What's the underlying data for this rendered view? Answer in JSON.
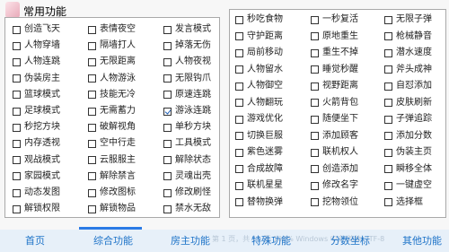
{
  "window": {
    "title": "常用功能"
  },
  "left_columns": [
    [
      {
        "label": "创造飞天",
        "checked": false
      },
      {
        "label": "人物穿墙",
        "checked": false
      },
      {
        "label": "人物连跳",
        "checked": false
      },
      {
        "label": "伪装房主",
        "checked": false
      },
      {
        "label": "篮球模式",
        "checked": false
      },
      {
        "label": "足球模式",
        "checked": false
      },
      {
        "label": "秒挖方块",
        "checked": false
      },
      {
        "label": "内存透视",
        "checked": false
      },
      {
        "label": "观战模式",
        "checked": false
      },
      {
        "label": "家园模式",
        "checked": false
      },
      {
        "label": "动态发图",
        "checked": false
      },
      {
        "label": "解锁权限",
        "checked": false
      }
    ],
    [
      {
        "label": "表情夜空",
        "checked": false
      },
      {
        "label": "隔墙打人",
        "checked": false
      },
      {
        "label": "无限距离",
        "checked": false
      },
      {
        "label": "人物游泳",
        "checked": false
      },
      {
        "label": "技能无冷",
        "checked": false
      },
      {
        "label": "无需蓄力",
        "checked": false
      },
      {
        "label": "破解视角",
        "checked": false
      },
      {
        "label": "空中行走",
        "checked": false
      },
      {
        "label": "云服服主",
        "checked": false
      },
      {
        "label": "解除禁言",
        "checked": false
      },
      {
        "label": "修改图标",
        "checked": false
      },
      {
        "label": "解锁物品",
        "checked": false
      }
    ],
    [
      {
        "label": "发言模式",
        "checked": false
      },
      {
        "label": "掉落无伤",
        "checked": false
      },
      {
        "label": "人物夜视",
        "checked": false
      },
      {
        "label": "无限钩爪",
        "checked": false
      },
      {
        "label": "原速连跳",
        "checked": false
      },
      {
        "label": "游泳连跳",
        "checked": true
      },
      {
        "label": "单秒方块",
        "checked": false
      },
      {
        "label": "工具模式",
        "checked": false
      },
      {
        "label": "解除状态",
        "checked": false
      },
      {
        "label": "灵魂出壳",
        "checked": false
      },
      {
        "label": "修改刷怪",
        "checked": false
      },
      {
        "label": "禁水无敌",
        "checked": false
      }
    ]
  ],
  "right_columns": [
    [
      {
        "label": "秒吃食物",
        "checked": false
      },
      {
        "label": "守护距离",
        "checked": false
      },
      {
        "label": "局前移动",
        "checked": false
      },
      {
        "label": "人物留水",
        "checked": false
      },
      {
        "label": "人物御空",
        "checked": false
      },
      {
        "label": "人物翻玩",
        "checked": false
      },
      {
        "label": "游戏优化",
        "checked": false
      },
      {
        "label": "切换巨服",
        "checked": false
      },
      {
        "label": "紫色迷雾",
        "checked": false
      },
      {
        "label": "合成故障",
        "checked": false
      },
      {
        "label": "联机星星",
        "checked": false
      },
      {
        "label": "替物换弹",
        "checked": false
      }
    ],
    [
      {
        "label": "一秒复活",
        "checked": false
      },
      {
        "label": "原地重生",
        "checked": false
      },
      {
        "label": "重生不掉",
        "checked": false
      },
      {
        "label": "睡觉秒醒",
        "checked": false
      },
      {
        "label": "视野距离",
        "checked": false
      },
      {
        "label": "火箭背包",
        "checked": false
      },
      {
        "label": "随便坐下",
        "checked": false
      },
      {
        "label": "添加顾客",
        "checked": false
      },
      {
        "label": "联机权人",
        "checked": false
      },
      {
        "label": "创造添加",
        "checked": false
      },
      {
        "label": "修改名字",
        "checked": false
      },
      {
        "label": "挖物领位",
        "checked": false
      }
    ],
    [
      {
        "label": "无限子弹",
        "checked": false
      },
      {
        "label": "枪械静音",
        "checked": false
      },
      {
        "label": "潜水速度",
        "checked": false
      },
      {
        "label": "斧头成神",
        "checked": false
      },
      {
        "label": "自怼添加",
        "checked": false
      },
      {
        "label": "皮肤刷新",
        "checked": false
      },
      {
        "label": "子弹追踪",
        "checked": false
      },
      {
        "label": "添加分数",
        "checked": false
      },
      {
        "label": "伪装主页",
        "checked": false
      },
      {
        "label": "瞬移全体",
        "checked": false
      },
      {
        "label": "一键虚空",
        "checked": false
      },
      {
        "label": "选择框",
        "checked": false
      }
    ]
  ],
  "tabs": [
    {
      "label": "首页",
      "active": false
    },
    {
      "label": "综合功能",
      "active": true
    },
    {
      "label": "房主功能",
      "active": false
    },
    {
      "label": "特殊功能",
      "active": false
    },
    {
      "label": "分数坐标",
      "active": false
    },
    {
      "label": "其他功能",
      "active": false
    }
  ],
  "status_text": "第 1 页，共 11 页    100%    Windows 中文(简体)    ITF-8",
  "colors": {
    "tab_text": "#1e73c8",
    "tab_bar": "#e7f0f9",
    "accent": "#2c7be5"
  }
}
